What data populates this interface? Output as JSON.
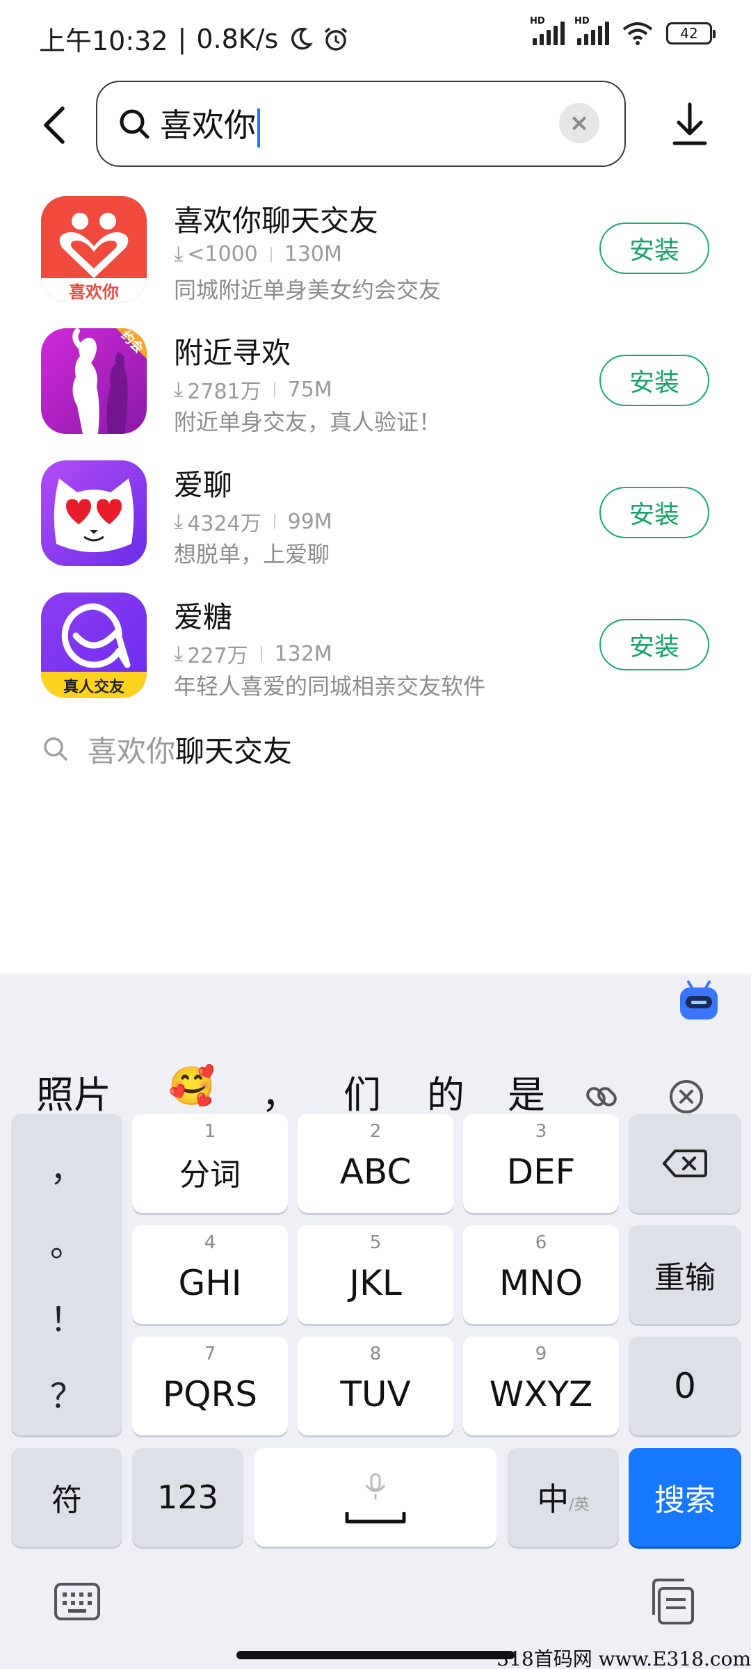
{
  "status_bar": {
    "time": "上午10:32",
    "network_speed": "0.8K/s",
    "battery": "42",
    "icons": [
      "moon-icon",
      "alarm-icon",
      "signal-icon",
      "signal-icon",
      "wifi-icon",
      "battery-icon"
    ]
  },
  "search": {
    "query": "喜欢你",
    "icons": [
      "back-icon",
      "search-icon",
      "clear-icon",
      "download-manager-icon"
    ]
  },
  "apps": [
    {
      "name": "喜欢你聊天交友",
      "downloads": "<1000",
      "size": "130M",
      "description": "同城附近单身美女约会交友",
      "install_label": "安装",
      "icon_text": "喜欢你",
      "icon_color": "#f0473e"
    },
    {
      "name": "附近寻欢",
      "downloads": "2781万",
      "size": "75M",
      "description": "附近单身交友，真人验证！",
      "install_label": "安装",
      "icon_text": "约会",
      "icon_color": "#b025c7"
    },
    {
      "name": "爱聊",
      "downloads": "4324万",
      "size": "99M",
      "description": "想脱单，上爱聊",
      "install_label": "安装",
      "icon_text": "",
      "icon_color": "#8a3cf0"
    },
    {
      "name": "爱糖",
      "downloads": "227万",
      "size": "132M",
      "description": "年轻人喜爱的同城相亲交友软件",
      "install_label": "安装",
      "icon_text": "真人交友",
      "icon_color": "#7b3af2"
    }
  ],
  "suggestion": {
    "highlight": "喜欢你",
    "rest": "聊天交友"
  },
  "keyboard": {
    "candidates": [
      "照片",
      "🥰",
      "，",
      "们",
      "的",
      "是"
    ],
    "candidate_icons": [
      "link-icon",
      "close-circle-icon"
    ],
    "punctuation": [
      "，",
      "。",
      "！",
      "？"
    ],
    "keys": [
      {
        "num": "1",
        "label": "分词"
      },
      {
        "num": "2",
        "label": "ABC"
      },
      {
        "num": "3",
        "label": "DEF"
      },
      {
        "num": "4",
        "label": "GHI"
      },
      {
        "num": "5",
        "label": "JKL"
      },
      {
        "num": "6",
        "label": "MNO"
      },
      {
        "num": "7",
        "label": "PQRS"
      },
      {
        "num": "8",
        "label": "TUV"
      },
      {
        "num": "9",
        "label": "WXYZ"
      }
    ],
    "reenter": "重输",
    "zero": "0",
    "symbol": "符",
    "numeric": "123",
    "lang_main": "中",
    "lang_alt": "/英",
    "search": "搜索",
    "accent_color": "#1677ff"
  },
  "watermark": "318首码网 www.E318.com"
}
